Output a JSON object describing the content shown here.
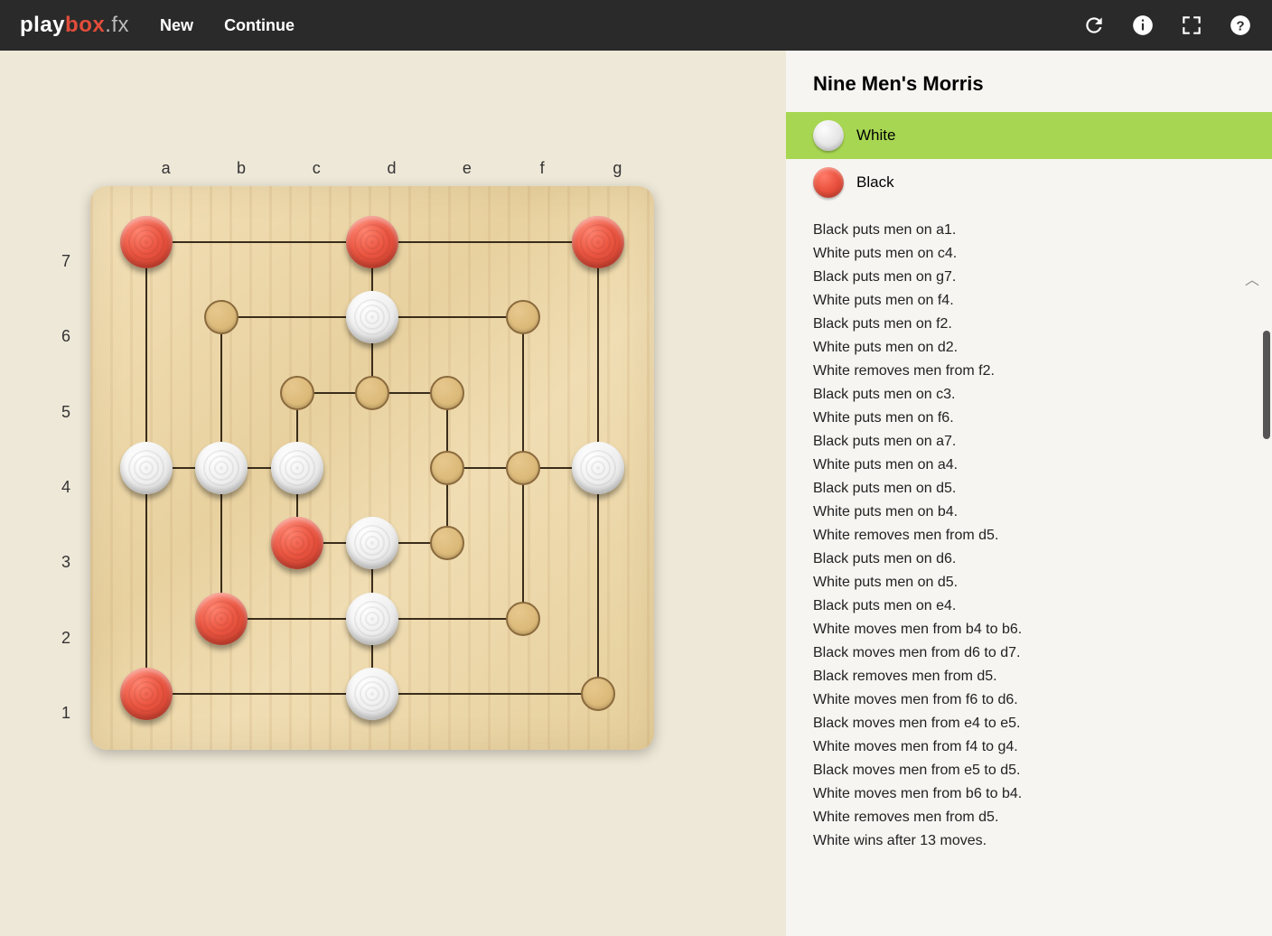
{
  "header": {
    "logo_play": "play",
    "logo_box": "box",
    "logo_fx": ".fx",
    "nav_new": "New",
    "nav_continue": "Continue"
  },
  "panel": {
    "title": "Nine Men's Morris",
    "player_white": "White",
    "player_black": "Black",
    "active_player": "white"
  },
  "board": {
    "cols": [
      "a",
      "b",
      "c",
      "d",
      "e",
      "f",
      "g"
    ],
    "rows": [
      "7",
      "6",
      "5",
      "4",
      "3",
      "2",
      "1"
    ],
    "points": [
      "a7",
      "d7",
      "g7",
      "b6",
      "d6",
      "f6",
      "c5",
      "d5",
      "e5",
      "a4",
      "b4",
      "c4",
      "e4",
      "f4",
      "g4",
      "c3",
      "d3",
      "e3",
      "b2",
      "d2",
      "f2",
      "a1",
      "d1",
      "g1"
    ],
    "pieces": {
      "a7": "R",
      "d7": "R",
      "g7": "R",
      "d6": "W",
      "a4": "W",
      "b4": "W",
      "c4": "W",
      "g4": "W",
      "c3": "R",
      "d3": "W",
      "b2": "R",
      "d2": "W",
      "a1": "R",
      "d1": "W"
    }
  },
  "history": [
    "Black puts men on a1.",
    "White puts men on c4.",
    "Black puts men on g7.",
    "White puts men on f4.",
    "Black puts men on f2.",
    "White puts men on d2.",
    "White removes men from f2.",
    "Black puts men on c3.",
    "White puts men on f6.",
    "Black puts men on a7.",
    "White puts men on a4.",
    "Black puts men on d5.",
    "White puts men on b4.",
    "White removes men from d5.",
    "Black puts men on d6.",
    "White puts men on d5.",
    "Black puts men on e4.",
    "White moves men from b4 to b6.",
    "Black moves men from d6 to d7.",
    "Black removes men from d5.",
    "White moves men from f6 to d6.",
    "Black moves men from e4 to e5.",
    "White moves men from f4 to g4.",
    "Black moves men from e5 to d5.",
    "White moves men from b6 to b4.",
    "White removes men from d5.",
    "White wins after 13 moves."
  ]
}
